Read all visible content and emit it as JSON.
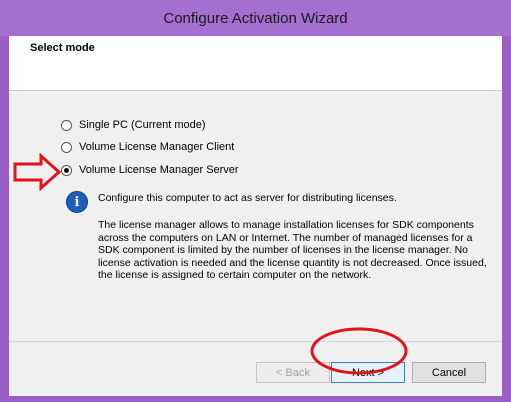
{
  "window": {
    "title": "Configure Activation Wizard"
  },
  "header": {
    "title": "Select mode"
  },
  "modes": [
    {
      "label": "Single PC (Current mode)",
      "checked": false
    },
    {
      "label": "Volume License Manager Client",
      "checked": false
    },
    {
      "label": "Volume License Manager Server",
      "checked": true
    }
  ],
  "info": {
    "icon": "info-icon",
    "summary": "Configure this computer to act as server for distributing licenses.",
    "details": "The license manager allows to manage installation licenses for SDK components across the computers on LAN or Internet. The number of managed licenses for a SDK component is limited by the number of licenses in the license manager. No license activation is needed and the license quantity is not decreased. Once issued, the license is assigned to certain computer on the network."
  },
  "footer": {
    "back_label": "< Back",
    "next_label": "Next >",
    "cancel_label": "Cancel"
  },
  "annotations": {
    "arrow_color": "#e0141b",
    "ellipse_color": "#e0141b"
  },
  "colors": {
    "frame": "#a56fd1",
    "content_bg": "#f0f0f0"
  }
}
